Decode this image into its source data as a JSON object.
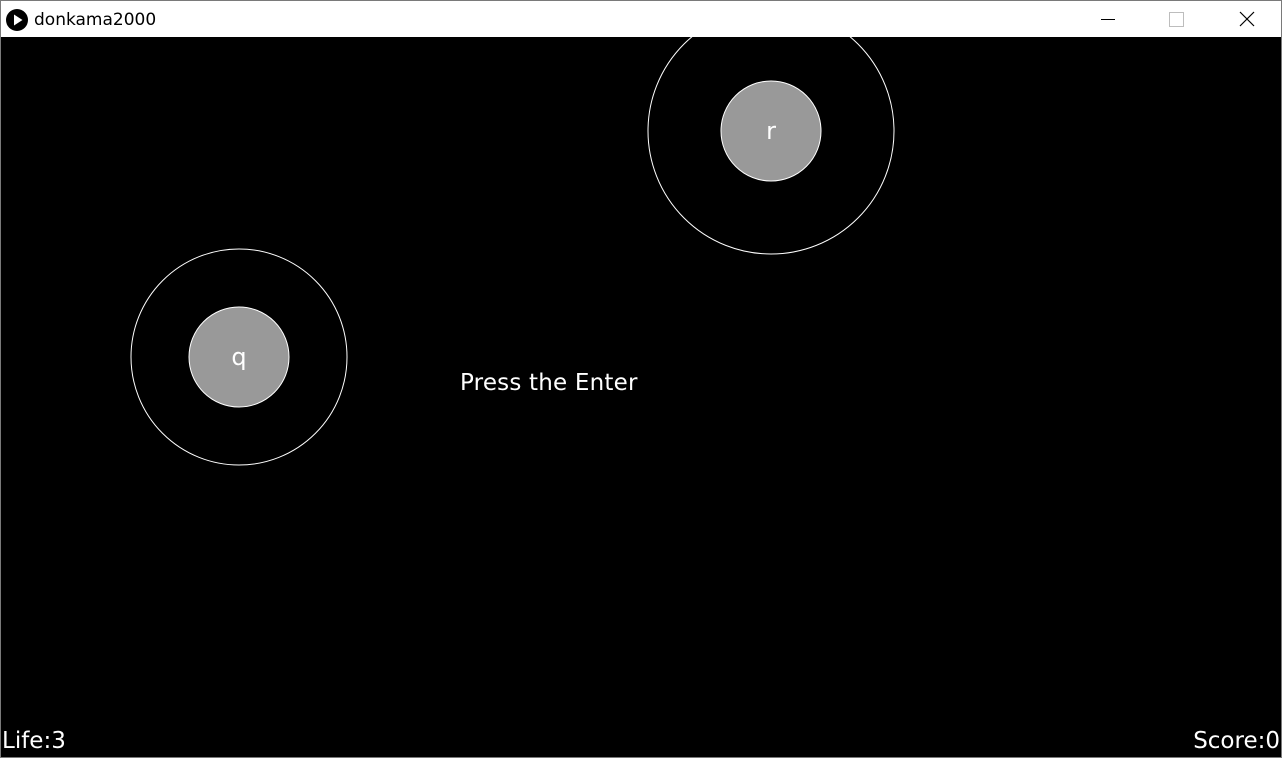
{
  "window": {
    "title": "donkama2000",
    "icon": "play-icon"
  },
  "controls": {
    "minimize_icon": "minimize-icon",
    "maximize_icon": "maximize-icon",
    "close_icon": "close-icon"
  },
  "game": {
    "prompt": "Press the Enter",
    "notes": [
      {
        "key": "q"
      },
      {
        "key": "r"
      }
    ],
    "life": "Life:3",
    "score": "Score:0"
  },
  "colors": {
    "background": "#000000",
    "note_fill": "#999999",
    "ring_stroke": "#ffffff",
    "text": "#ffffff"
  }
}
